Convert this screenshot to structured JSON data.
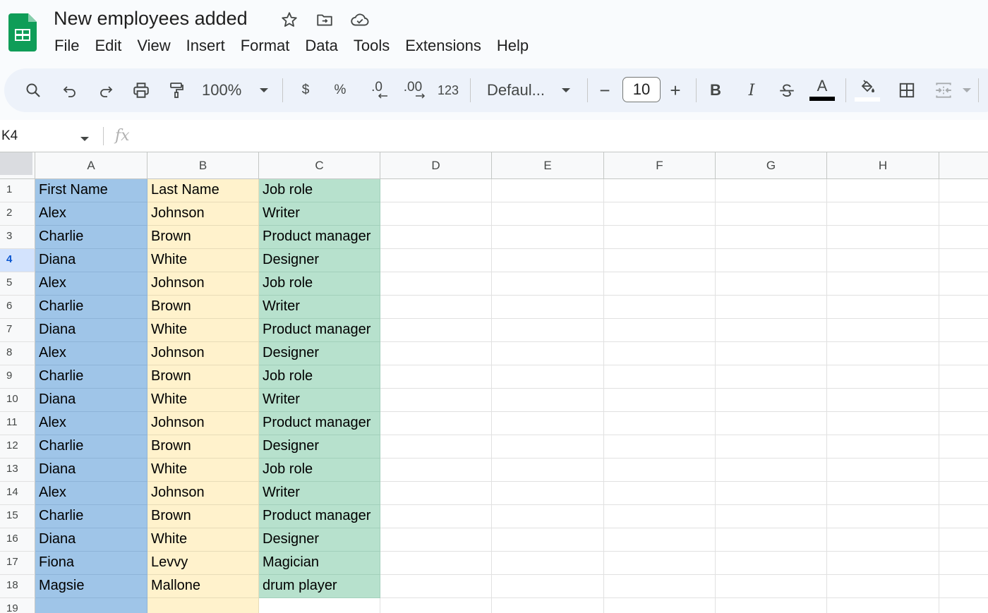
{
  "document": {
    "title": "New employees added"
  },
  "menu": [
    "File",
    "Edit",
    "View",
    "Insert",
    "Format",
    "Data",
    "Tools",
    "Extensions",
    "Help"
  ],
  "toolbar": {
    "zoom": "100%",
    "currency": "$",
    "percent": "%",
    "decrease_decimal": ".0",
    "increase_decimal": ".00",
    "number_format": "123",
    "font": "Defaul...",
    "font_size": "10",
    "minus": "−",
    "plus": "+",
    "bold": "B",
    "italic": "I",
    "text_color_letter": "A",
    "text_color": "#000000",
    "fill_color": "#ffffff"
  },
  "formula_bar": {
    "name_box": "K4",
    "fx": "fx"
  },
  "grid": {
    "columns": [
      "A",
      "B",
      "C",
      "D",
      "E",
      "F",
      "G",
      "H"
    ],
    "active_row": 4,
    "rows": [
      [
        " First Name",
        "Last Name",
        "Job role"
      ],
      [
        "Alex",
        "Johnson",
        "Writer"
      ],
      [
        "Charlie",
        "Brown",
        "Product manager"
      ],
      [
        "Diana",
        "White",
        "Designer"
      ],
      [
        "Alex",
        "Johnson",
        "Job role"
      ],
      [
        "Charlie",
        "Brown",
        "Writer"
      ],
      [
        "Diana",
        "White",
        "Product manager"
      ],
      [
        "Alex",
        "Johnson",
        "Designer"
      ],
      [
        "Charlie",
        "Brown",
        "Job role"
      ],
      [
        "Diana",
        "White",
        "Writer"
      ],
      [
        "Alex",
        "Johnson",
        "Product manager"
      ],
      [
        "Charlie",
        "Brown",
        "Designer"
      ],
      [
        "Diana",
        "White",
        "Job role"
      ],
      [
        "Alex",
        "Johnson",
        "Writer"
      ],
      [
        "Charlie",
        "Brown",
        "Product manager"
      ],
      [
        "Diana",
        "White",
        "Designer"
      ],
      [
        "Fiona",
        "Levvy",
        "Magician"
      ],
      [
        "Magsie",
        "Mallone",
        "drum player"
      ],
      [
        "",
        "",
        ""
      ]
    ],
    "colors": {
      "A": "#9fc5e8",
      "B": "#fff2cc",
      "C": "#b7e1cd"
    }
  }
}
